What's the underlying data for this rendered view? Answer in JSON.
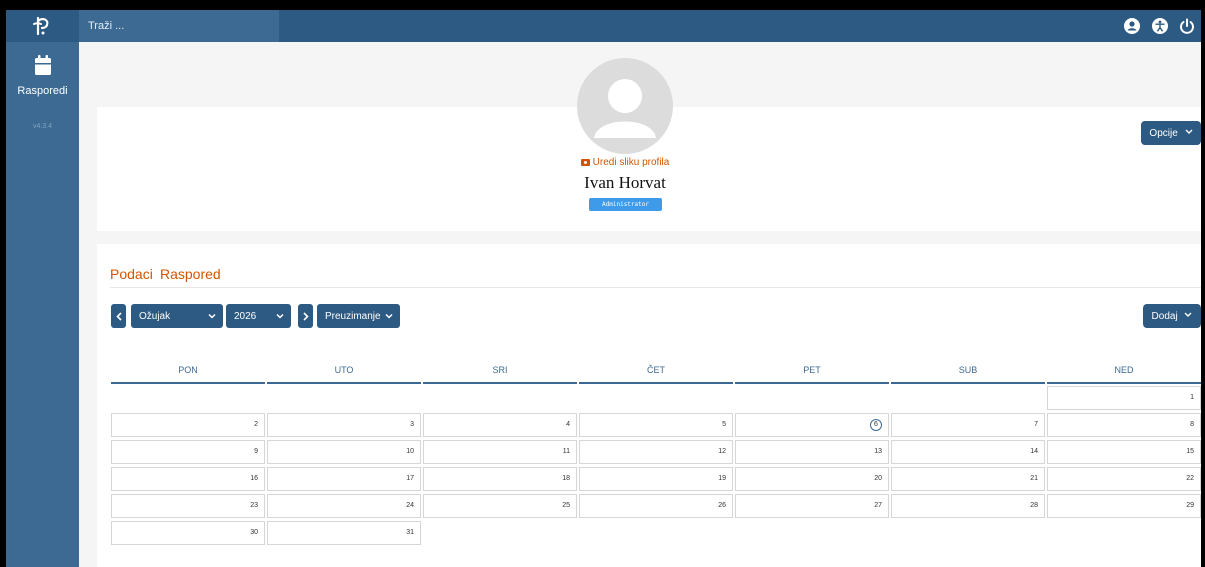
{
  "app": {
    "sidebar": {
      "nav_label": "Rasporedi",
      "version": "v4.3.4"
    },
    "search_placeholder": "Traži ..."
  },
  "profile": {
    "edit_photo": "Uredi sliku profila",
    "name": "Ivan Horvat",
    "role": "Administrator",
    "options_button": "Opcije"
  },
  "tabs": [
    "Podaci",
    "Raspored"
  ],
  "schedule": {
    "month": "Ožujak",
    "year": "2026",
    "download_button": "Preuzimanje",
    "add_button": "Dodaj",
    "weekdays": [
      "PON",
      "UTO",
      "SRI",
      "ČET",
      "PET",
      "SUB",
      "NED"
    ],
    "today": "6",
    "weeks": [
      [
        "",
        "",
        "",
        "",
        "",
        "",
        "1"
      ],
      [
        "2",
        "3",
        "4",
        "5",
        "6",
        "7",
        "8"
      ],
      [
        "9",
        "10",
        "11",
        "12",
        "13",
        "14",
        "15"
      ],
      [
        "16",
        "17",
        "18",
        "19",
        "20",
        "21",
        "22"
      ],
      [
        "23",
        "24",
        "25",
        "26",
        "27",
        "28",
        "29"
      ],
      [
        "30",
        "31",
        "",
        "",
        "",
        "",
        ""
      ]
    ]
  },
  "colors": {
    "brand": "#2d5a82",
    "sidebar": "#3c6a93",
    "accent": "#d35400",
    "badge": "#3d9be9"
  },
  "icons": [
    "app-logo-icon",
    "calendar-icon",
    "user-icon",
    "accessibility-icon",
    "power-icon",
    "camera-icon",
    "chevron-left-icon",
    "chevron-right-icon",
    "chevron-down-icon"
  ]
}
